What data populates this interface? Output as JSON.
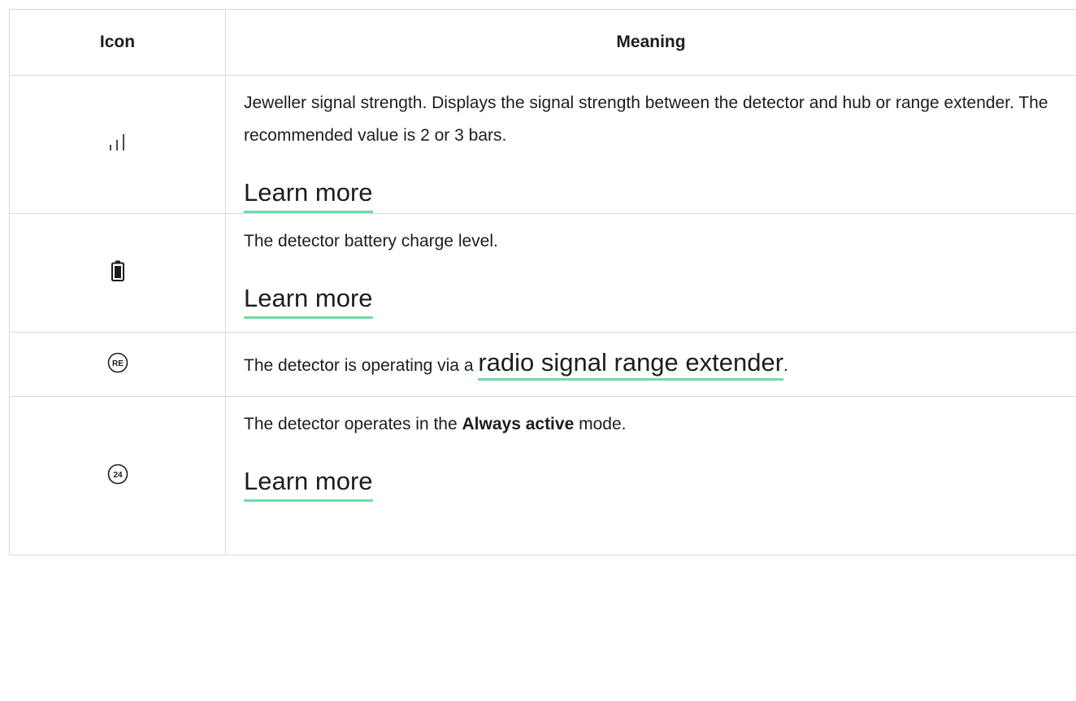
{
  "header": {
    "icon_col": "Icon",
    "meaning_col": "Meaning"
  },
  "rows": [
    {
      "icon": "signal-strength-icon",
      "text": "Jeweller signal strength. Displays the signal strength between the detector and hub or range extender. The recommended value is 2 or 3 bars.",
      "link": "Learn more"
    },
    {
      "icon": "battery-icon",
      "text": "The detector battery charge level.",
      "link": "Learn more"
    },
    {
      "icon": "range-extender-icon",
      "icon_text": "RE",
      "text_before": "The detector is operating via a ",
      "link": "radio signal range extender",
      "text_after": "."
    },
    {
      "icon": "always-active-icon",
      "icon_text": "24",
      "text_before": "The detector operates in the ",
      "bold": "Always active",
      "text_after": " mode.",
      "link": "Learn more"
    }
  ],
  "colors": {
    "link_underline": "#6ddca8",
    "border": "#d9d9d9",
    "text": "#1d1d1d"
  }
}
